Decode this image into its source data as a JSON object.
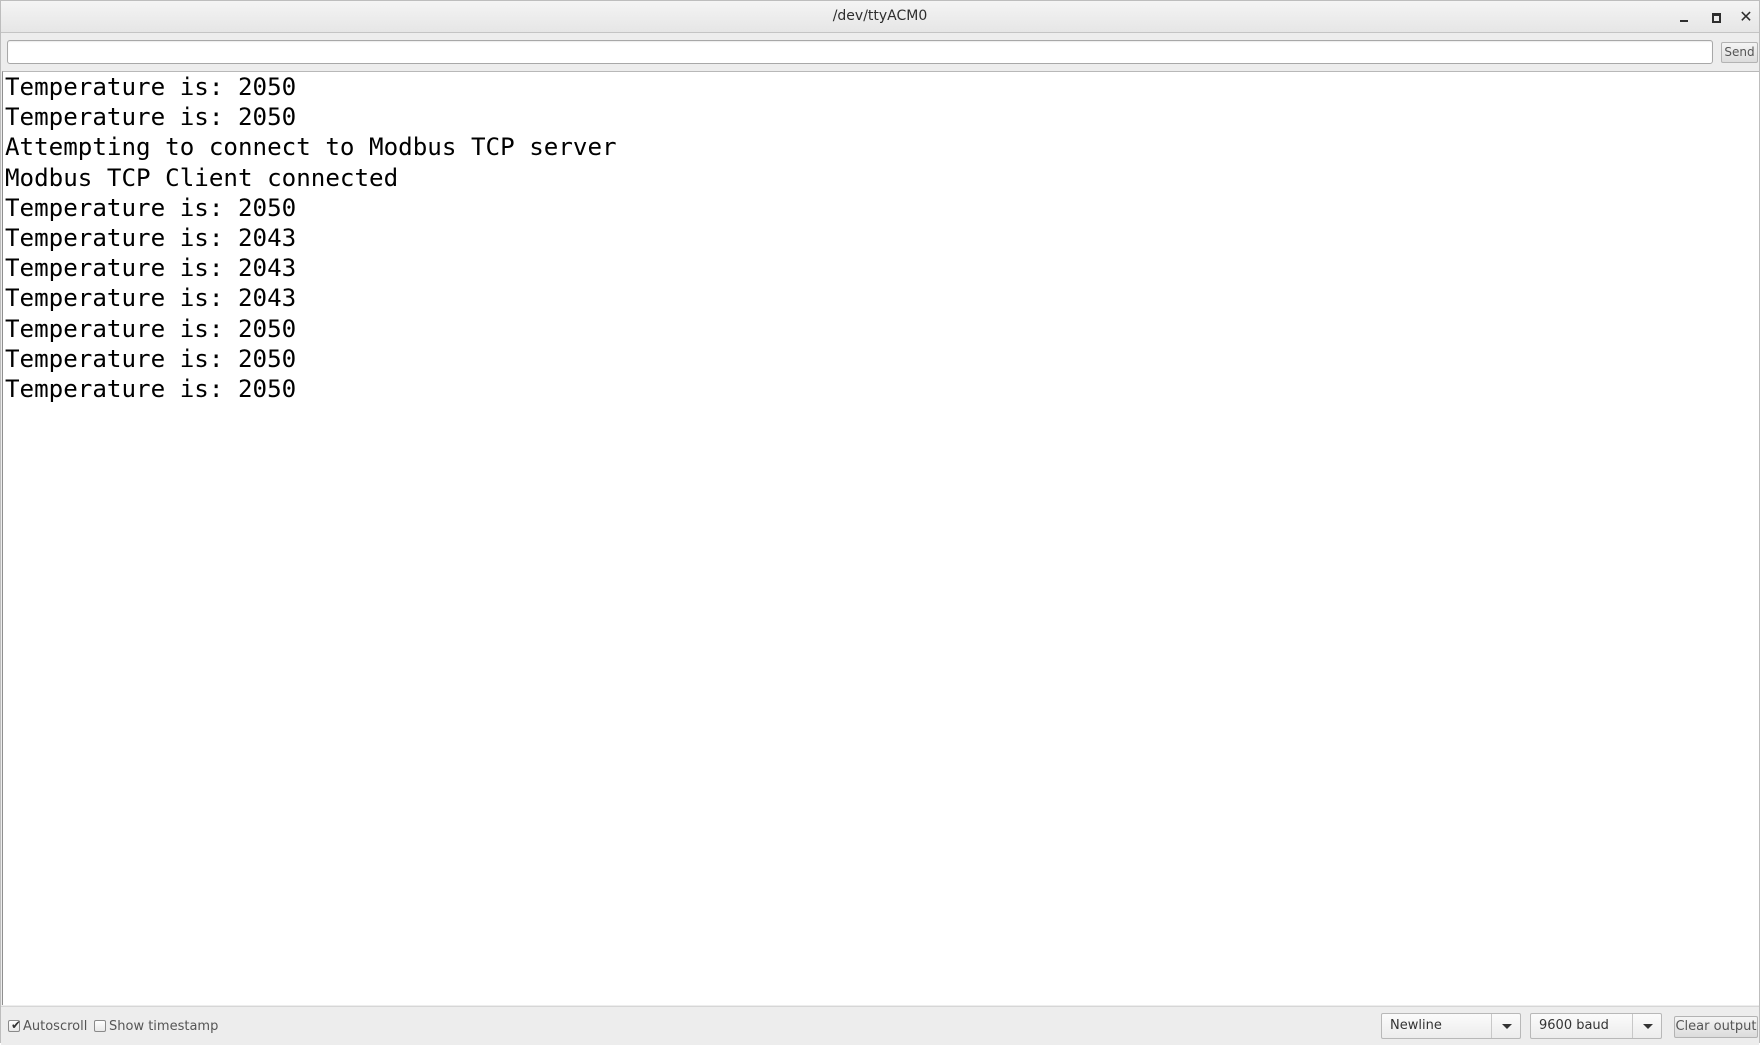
{
  "window": {
    "title": "/dev/ttyACM0",
    "controls": {
      "minimize_icon": "minimize-icon",
      "maximize_icon": "maximize-icon",
      "close_glyph": "✕"
    }
  },
  "send_row": {
    "input_value": "",
    "send_label": "Send"
  },
  "output": {
    "lines": [
      "Temperature is: 2050",
      "Temperature is: 2050",
      "Attempting to connect to Modbus TCP server",
      "Modbus TCP Client connected",
      "Temperature is: 2050",
      "Temperature is: 2043",
      "Temperature is: 2043",
      "Temperature is: 2043",
      "Temperature is: 2050",
      "Temperature is: 2050",
      "Temperature is: 2050"
    ]
  },
  "bottom": {
    "autoscroll": {
      "label": "Autoscroll",
      "checked": true,
      "tick": "✔"
    },
    "show_timestamp": {
      "label": "Show timestamp",
      "checked": false
    },
    "line_ending": {
      "selected": "Newline"
    },
    "baud_rate": {
      "selected": "9600 baud"
    },
    "clear_label": "Clear output"
  }
}
